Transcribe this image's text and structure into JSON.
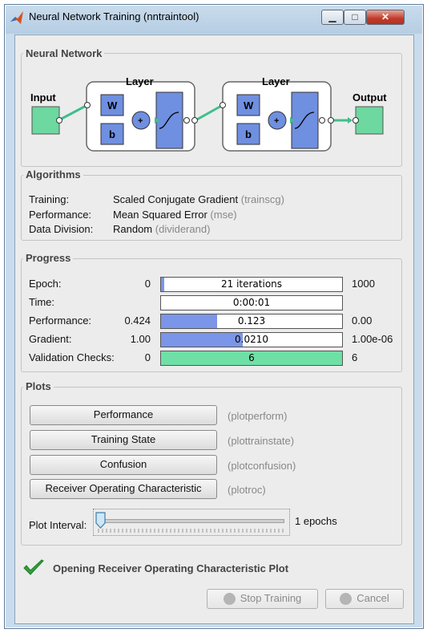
{
  "window": {
    "title": "Neural Network Training (nntraintool)",
    "minimize": "▁",
    "maximize": "□",
    "close": "✕"
  },
  "network": {
    "group_title": "Neural Network",
    "input_label": "Input",
    "output_label": "Output",
    "layer1_label": "Layer",
    "layer2_label": "Layer",
    "w_label": "W",
    "b_label": "b",
    "plus": "+"
  },
  "algorithms": {
    "group_title": "Algorithms",
    "rows": [
      {
        "label": "Training:",
        "value": "Scaled Conjugate Gradient",
        "fn": "(trainscg)"
      },
      {
        "label": "Performance:",
        "value": "Mean Squared Error",
        "fn": "(mse)"
      },
      {
        "label": "Data Division:",
        "value": "Random",
        "fn": "(dividerand)"
      }
    ]
  },
  "progress": {
    "group_title": "Progress",
    "rows": [
      {
        "label": "Epoch:",
        "start": "0",
        "bar_text": "21 iterations",
        "end": "1000",
        "fill_fraction": 0.021,
        "fill_color": "#7b95e8"
      },
      {
        "label": "Time:",
        "start": "",
        "bar_text": "0:00:01",
        "end": "",
        "fill_fraction": 0,
        "fill_color": "#7b95e8"
      },
      {
        "label": "Performance:",
        "start": "0.424",
        "bar_text": "0.123",
        "end": "0.00",
        "fill_fraction": 0.31,
        "fill_color": "#7b95e8"
      },
      {
        "label": "Gradient:",
        "start": "1.00",
        "bar_text": "0.0210",
        "end": "1.00e-06",
        "fill_fraction": 0.45,
        "fill_color": "#7b95e8"
      },
      {
        "label": "Validation Checks:",
        "start": "0",
        "bar_text": "6",
        "end": "6",
        "fill_fraction": 1.0,
        "fill_color": "#6ee0a5"
      }
    ]
  },
  "plots": {
    "group_title": "Plots",
    "buttons": [
      {
        "label": "Performance",
        "fn": "(plotperform)"
      },
      {
        "label": "Training State",
        "fn": "(plottrainstate)"
      },
      {
        "label": "Confusion",
        "fn": "(plotconfusion)"
      },
      {
        "label": "Receiver Operating Characteristic",
        "fn": "(plotroc)"
      }
    ],
    "interval_label": "Plot Interval:",
    "interval_value": "1 epochs",
    "interval_slider_fraction": 0
  },
  "status": {
    "message": "Opening Receiver Operating Characteristic Plot"
  },
  "footer": {
    "stop_label": "Stop Training",
    "cancel_label": "Cancel"
  },
  "colors": {
    "block_blue": "#6f8fe0",
    "io_green": "#6dd8a0",
    "wire_green": "#3fbf8a"
  }
}
